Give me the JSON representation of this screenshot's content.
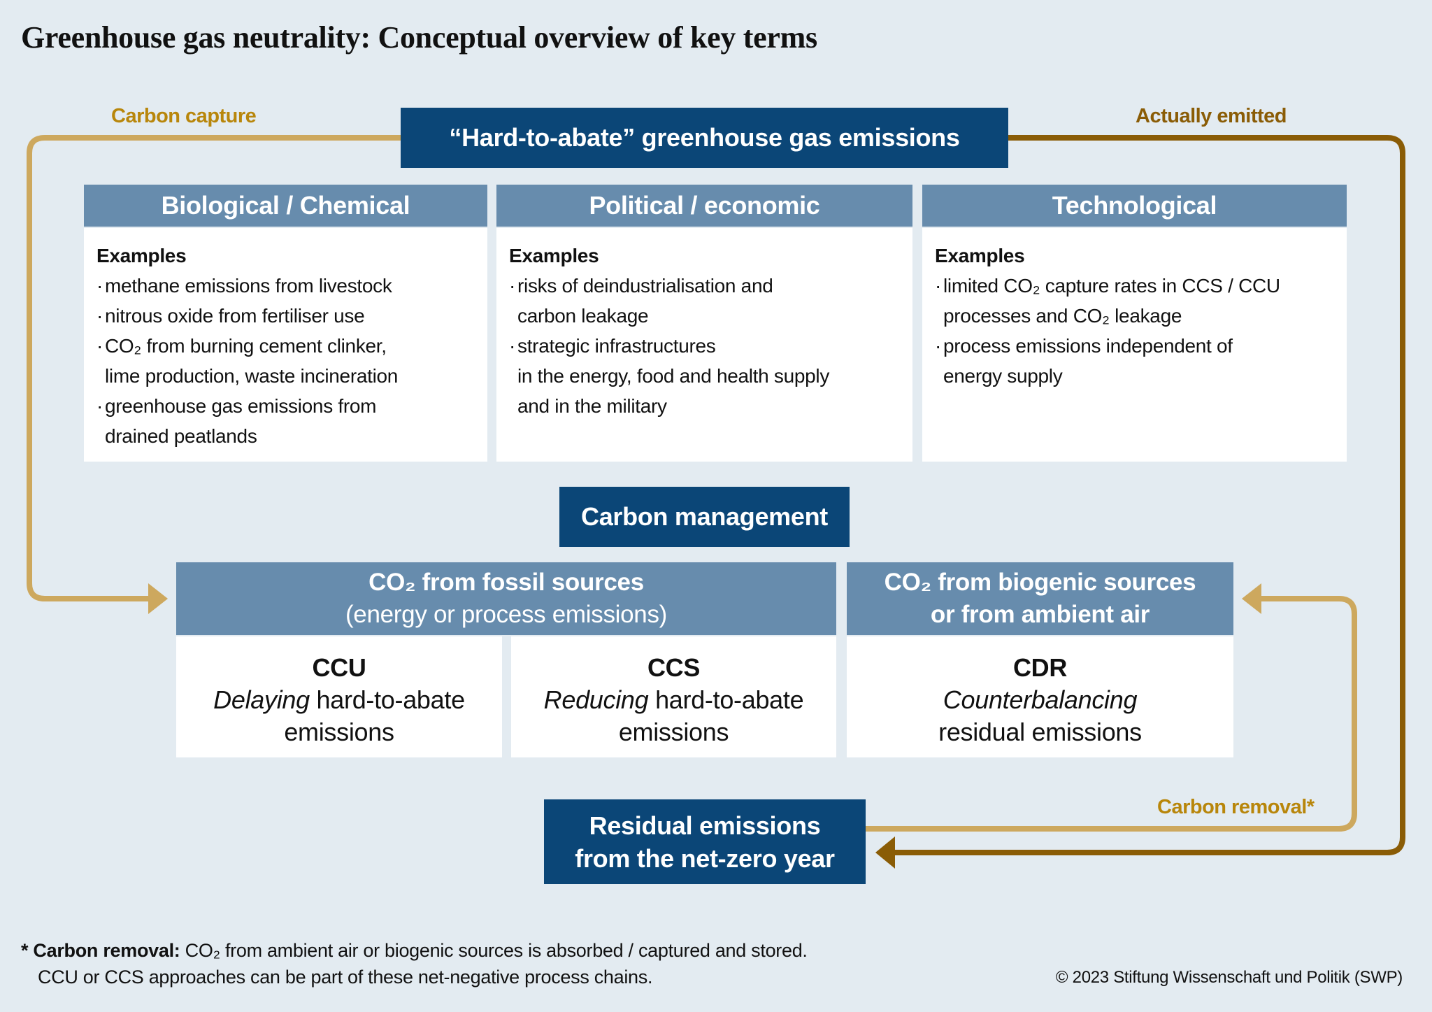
{
  "title": "Greenhouse gas neutrality: Conceptual overview of key terms",
  "colors": {
    "background": "#e3ebf1",
    "dark_blue": "#0b4677",
    "header_blue": "#678cad",
    "carbon_capture_gold": "#cda85e",
    "actually_emitted_brown": "#8a5c06"
  },
  "flows": {
    "carbon_capture": "Carbon capture",
    "actually_emitted": "Actually emitted",
    "carbon_removal": "Carbon removal*"
  },
  "hard_to_abate": {
    "title": "“Hard-to-abate” greenhouse gas emissions",
    "categories": [
      {
        "header": "Biological / Chemical",
        "examples_label": "Examples",
        "items": [
          [
            "methane emissions from livestock"
          ],
          [
            "nitrous oxide from fertiliser use"
          ],
          [
            "CO₂ from burning cement clinker,",
            "lime production, waste incineration"
          ],
          [
            "greenhouse gas emissions from",
            "drained peatlands"
          ]
        ]
      },
      {
        "header": "Political / economic",
        "examples_label": "Examples",
        "items": [
          [
            "risks of deindustrialisation and",
            "carbon leakage"
          ],
          [
            "strategic infrastructures",
            "in the energy, food and health supply",
            "and in the military"
          ]
        ]
      },
      {
        "header": "Technological",
        "examples_label": "Examples",
        "items": [
          [
            "limited CO₂ capture rates in CCS / CCU",
            "processes and CO₂ leakage"
          ],
          [
            "process emissions independent of",
            "energy supply"
          ]
        ]
      }
    ]
  },
  "carbon_management": {
    "title": "Carbon management",
    "fossil_header_line1": "CO₂ from fossil sources",
    "fossil_header_line2": "(energy or process emissions)",
    "biogenic_header_line1": "CO₂ from biogenic sources",
    "biogenic_header_line2": "or from ambient air",
    "terms": [
      {
        "acronym": "CCU",
        "emph": "Delaying",
        "rest": " hard-to-abate",
        "line2": "emissions"
      },
      {
        "acronym": "CCS",
        "emph": "Reducing",
        "rest": " hard-to-abate",
        "line2": "emissions"
      },
      {
        "acronym": "CDR",
        "emph": "Counterbalancing",
        "rest": "",
        "line2": "residual emissions"
      }
    ]
  },
  "residual": {
    "line1": "Residual emissions",
    "line2": "from the net-zero year"
  },
  "footnote": {
    "marker": "*",
    "bold": "Carbon removal:",
    "line1": " CO₂ from ambient air or biogenic sources is absorbed / captured and stored.",
    "line2": "CCU or CCS approaches can be part of these net-negative process chains."
  },
  "copyright": "© 2023 Stiftung Wissenschaft und Politik (SWP)"
}
